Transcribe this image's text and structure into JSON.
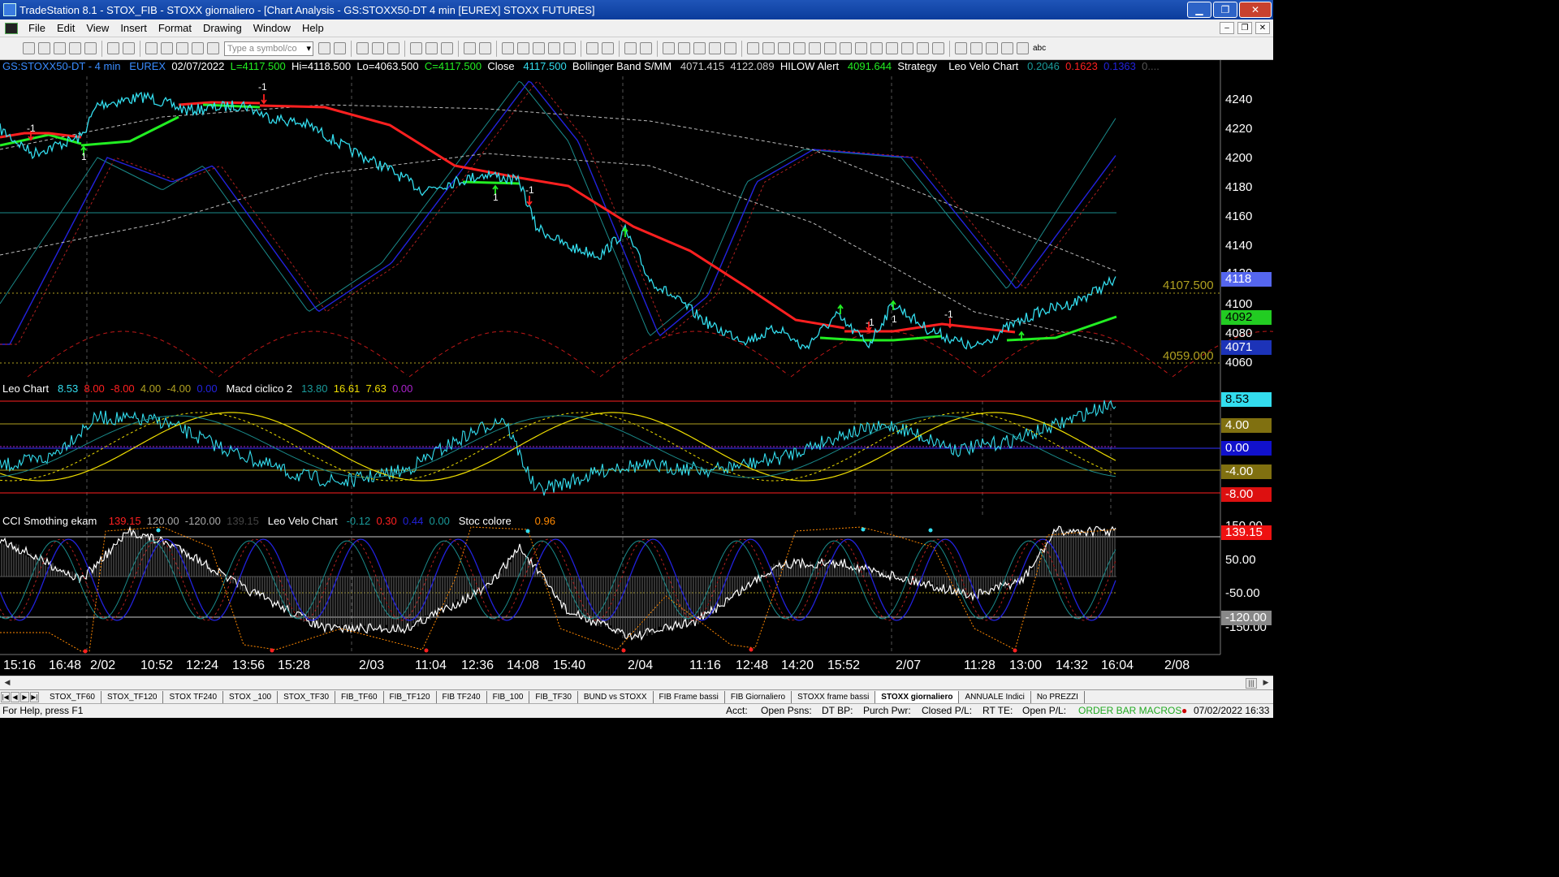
{
  "window": {
    "title": "TradeStation 8.1 - STOX_FIB - STOXX giornaliero - [Chart Analysis - GS:STOXX50-DT  4 min  [EUREX] STOXX FUTURES]",
    "minimize": "▁",
    "restore": "❐",
    "close": "✕"
  },
  "menu": {
    "items": [
      "File",
      "Edit",
      "View",
      "Insert",
      "Format",
      "Drawing",
      "Window",
      "Help"
    ],
    "mdi_min": "–",
    "mdi_restore": "❐",
    "mdi_close": "✕"
  },
  "toolbar": {
    "symbol_placeholder": "Type a symbol/co",
    "text_tool": "abc"
  },
  "panel1": {
    "symbol": "GS:STOXX50-DT - 4 min",
    "exchange": "EUREX",
    "date": "02/07/2022",
    "last": "L=4117.500",
    "high": "Hi=4118.500",
    "low": "Lo=4063.500",
    "close_eq": "C=4117.500",
    "close_label": "Close",
    "close_val": "4117.500",
    "bb_label": "Bollinger Band S/MM",
    "bb_val1": "4071.415",
    "bb_val2": "4122.089",
    "hilow_label": "HILOW Alert",
    "hilow_val": "4091.644",
    "strategy_label": "Strategy",
    "leo_label": "Leo Velo Chart",
    "leo_v1": "0.2046",
    "leo_v2": "0.1623",
    "leo_v3": "0.1363",
    "leo_more": "0....",
    "yticks": [
      "4240",
      "4220",
      "4200",
      "4180",
      "4160",
      "4140",
      "4120",
      "4100",
      "4080",
      "4060"
    ],
    "level_hi": "4107.500",
    "level_lo": "4059.000",
    "price_now": "4118",
    "price_green": "4092",
    "price_blue": "4071",
    "trade_markers": [
      "-1",
      "1",
      "-1",
      "1",
      "-1",
      "-1",
      "1",
      "-1"
    ]
  },
  "panel2": {
    "leo_label": "Leo Chart",
    "v1": "8.53",
    "v2": "8.00",
    "v3": "-8.00",
    "v4": "4.00",
    "v5": "-4.00",
    "v6": "0.00",
    "macd_label": "Macd ciclico 2",
    "m1": "13.80",
    "m2": "16.61",
    "m3": "7.63",
    "m4": "0.00",
    "boxes": [
      "8.53",
      "4.00",
      "0.00",
      "-4.00",
      "-8.00"
    ]
  },
  "panel3": {
    "cci_label": "CCI Smothing ekam",
    "c1": "139.15",
    "c2": "120.00",
    "c3": "-120.00",
    "c4": "139.15",
    "leo_label": "Leo Velo Chart",
    "l1": "-0.12",
    "l2": "0.30",
    "l3": "0.44",
    "l4": "0.00",
    "stoc_label": "Stoc colore",
    "s1": "0.96",
    "yticks": [
      "150.00",
      "50.00",
      "-50.00",
      "-150.00"
    ],
    "box_top": "139.15",
    "box_bottom": "-120.00"
  },
  "time_axis": [
    "15:16",
    "16:48",
    "2/02",
    "10:52",
    "12:24",
    "13:56",
    "15:28",
    "2/03",
    "11:04",
    "12:36",
    "14:08",
    "15:40",
    "2/04",
    "11:16",
    "12:48",
    "14:20",
    "15:52",
    "2/07",
    "11:28",
    "13:00",
    "14:32",
    "16:04",
    "2/08"
  ],
  "tabs": [
    "STOX_TF60",
    "STOX_TF120",
    "STOX TF240",
    "STOX _100",
    "STOX_TF30",
    "FIB_TF60",
    "FIB_TF120",
    "FIB TF240",
    "FIB_100",
    "FIB_TF30",
    "BUND vs STOXX",
    "FIB Frame bassi",
    "FIB Giornaliero",
    "STOXX frame bassi",
    "STOXX giornaliero",
    "ANNUALE Indici",
    "No PREZZI"
  ],
  "active_tab": "STOXX giornaliero",
  "status": {
    "help": "For Help, press F1",
    "acct": "Acct:",
    "open_psns": "Open Psns:",
    "dt_bp": "DT BP:",
    "purch_pwr": "Purch Pwr:",
    "closed_pl": "Closed P/L:",
    "rt_te": "RT TE:",
    "open_pl": "Open P/L:",
    "macros": "ORDER BAR MACROS",
    "datetime": "07/02/2022 16:33"
  },
  "colors": {
    "cyan": "#33ddee",
    "red": "#ff2020",
    "green": "#22ee22",
    "olive": "#b0a020",
    "blue": "#2222dd",
    "teal": "#1a8a8a"
  }
}
